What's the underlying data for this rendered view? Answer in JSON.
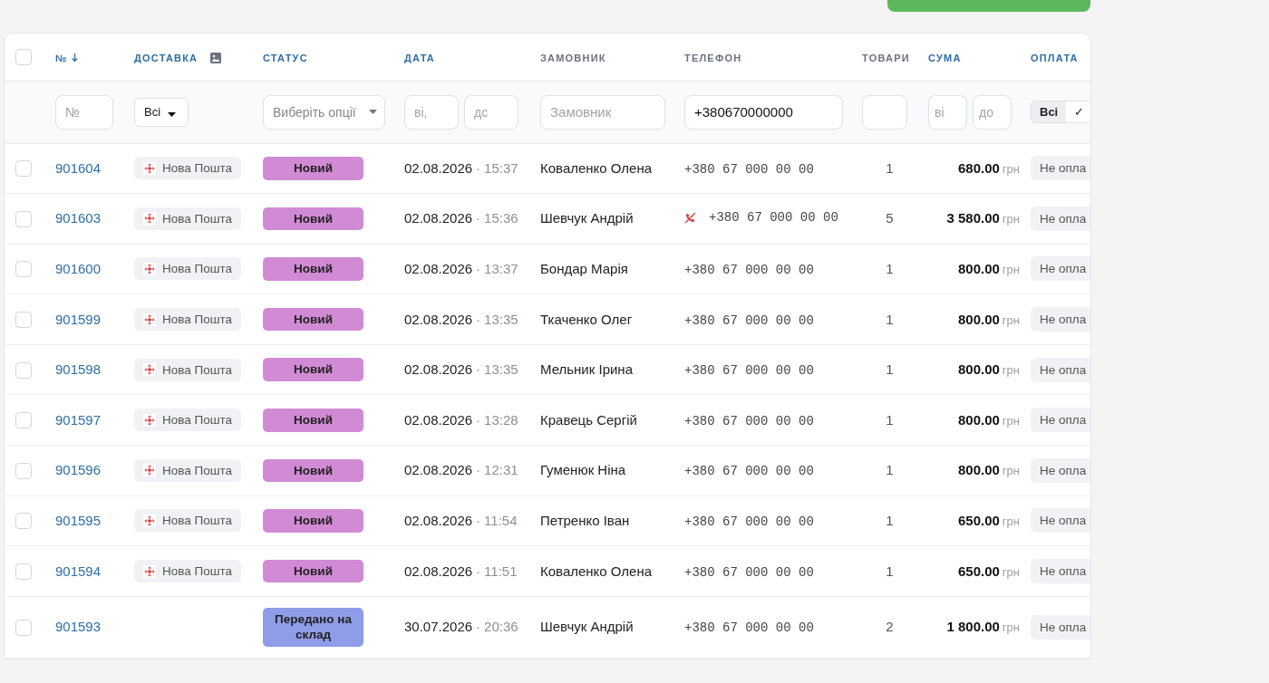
{
  "header_checkbox": {
    "checked": false
  },
  "columns": [
    {
      "label": "№",
      "sortable": true,
      "sorted": true
    },
    {
      "label": "ДОСТАВКА",
      "sortable": true,
      "image_icon": true
    },
    {
      "label": "СТАТУС",
      "sortable": true
    },
    {
      "label": "ДАТА",
      "sortable": true
    },
    {
      "label": "ЗАМОВНИК",
      "sortable": false
    },
    {
      "label": "ТЕЛЕФОН",
      "sortable": false
    },
    {
      "label": "ТОВАРИ",
      "sortable": false
    },
    {
      "label": "СУМА",
      "sortable": true
    },
    {
      "label": "ОПЛАТА",
      "sortable": true
    }
  ],
  "filters": [
    {
      "kind": "text",
      "placeholder": "№"
    },
    {
      "kind": "select",
      "value": "Всі"
    },
    {
      "kind": "multiselect",
      "placeholder": "Виберіть опції"
    },
    {
      "kind": "range",
      "fields": [
        {
          "placeholder": "ві,"
        },
        {
          "placeholder": "дс"
        }
      ]
    },
    {
      "kind": "text",
      "placeholder": "Замовник"
    },
    {
      "kind": "value",
      "value": "+380670000000"
    },
    {
      "kind": "empty"
    },
    {
      "kind": "range",
      "fields": [
        {
          "placeholder": "ві"
        },
        {
          "placeholder": "до"
        }
      ]
    },
    {
      "kind": "toggle",
      "options": [
        {
          "label": "Всі",
          "selected": true
        },
        {
          "label": "✓",
          "selected": false
        }
      ]
    }
  ],
  "rows": [
    {
      "checked": false,
      "number": "901604",
      "delivery": "Нова Пошта",
      "status": "Новий",
      "color": "#d18ad4",
      "date": "02.08.2026",
      "separator": "·",
      "time": "15:37",
      "customer": "Коваленко Олена",
      "phone": "+380 67 000 00 00",
      "phone_flag": false,
      "items": "1",
      "sum": "680.00",
      "currency": "грн",
      "payment": "Не опла"
    },
    {
      "checked": false,
      "number": "901603",
      "delivery": "Нова Пошта",
      "status": "Новий",
      "color": "#d18ad4",
      "date": "02.08.2026",
      "separator": "·",
      "time": "15:36",
      "customer": "Шевчук Андрій",
      "phone": "+380 67 000 00 00",
      "phone_flag": true,
      "items": "5",
      "sum": "3 580.00",
      "currency": "грн",
      "payment": "Не опла"
    },
    {
      "checked": false,
      "number": "901600",
      "delivery": "Нова Пошта",
      "status": "Новий",
      "color": "#d18ad4",
      "date": "02.08.2026",
      "separator": "·",
      "time": "13:37",
      "customer": "Бондар Марія",
      "phone": "+380 67 000 00 00",
      "phone_flag": false,
      "items": "1",
      "sum": "800.00",
      "currency": "грн",
      "payment": "Не опла"
    },
    {
      "checked": false,
      "number": "901599",
      "delivery": "Нова Пошта",
      "status": "Новий",
      "color": "#d18ad4",
      "date": "02.08.2026",
      "separator": "·",
      "time": "13:35",
      "customer": "Ткаченко Олег",
      "phone": "+380 67 000 00 00",
      "phone_flag": false,
      "items": "1",
      "sum": "800.00",
      "currency": "грн",
      "payment": "Не опла"
    },
    {
      "checked": false,
      "number": "901598",
      "delivery": "Нова Пошта",
      "status": "Новий",
      "color": "#d18ad4",
      "date": "02.08.2026",
      "separator": "·",
      "time": "13:35",
      "customer": "Мельник Ірина",
      "phone": "+380 67 000 00 00",
      "phone_flag": false,
      "items": "1",
      "sum": "800.00",
      "currency": "грн",
      "payment": "Не опла"
    },
    {
      "checked": false,
      "number": "901597",
      "delivery": "Нова Пошта",
      "status": "Новий",
      "color": "#d18ad4",
      "date": "02.08.2026",
      "separator": "·",
      "time": "13:28",
      "customer": "Кравець Сергій",
      "phone": "+380 67 000 00 00",
      "phone_flag": false,
      "items": "1",
      "sum": "800.00",
      "currency": "грн",
      "payment": "Не опла"
    },
    {
      "checked": false,
      "number": "901596",
      "delivery": "Нова Пошта",
      "status": "Новий",
      "color": "#d18ad4",
      "date": "02.08.2026",
      "separator": "·",
      "time": "12:31",
      "customer": "Гуменюк Ніна",
      "phone": "+380 67 000 00 00",
      "phone_flag": false,
      "items": "1",
      "sum": "800.00",
      "currency": "грн",
      "payment": "Не опла"
    },
    {
      "checked": false,
      "number": "901595",
      "delivery": "Нова Пошта",
      "status": "Новий",
      "color": "#d18ad4",
      "date": "02.08.2026",
      "separator": "·",
      "time": "11:54",
      "customer": "Петренко Іван",
      "phone": "+380 67 000 00 00",
      "phone_flag": false,
      "items": "1",
      "sum": "650.00",
      "currency": "грн",
      "payment": "Не опла"
    },
    {
      "checked": false,
      "number": "901594",
      "delivery": "Нова Пошта",
      "status": "Новий",
      "color": "#d18ad4",
      "date": "02.08.2026",
      "separator": "·",
      "time": "11:51",
      "customer": "Коваленко Олена",
      "phone": "+380 67 000 00 00",
      "phone_flag": false,
      "items": "1",
      "sum": "650.00",
      "currency": "грн",
      "payment": "Не опла"
    },
    {
      "checked": false,
      "number": "901593",
      "status": "Передано на склад",
      "color": "#8f9ce8",
      "date": "30.07.2026",
      "separator": "·",
      "time": "20:36",
      "customer": "Шевчук Андрій",
      "phone": "+380 67 000 00 00",
      "phone_flag": false,
      "items": "2",
      "sum": "1 800.00",
      "currency": "грн",
      "payment": "Не опла"
    }
  ]
}
